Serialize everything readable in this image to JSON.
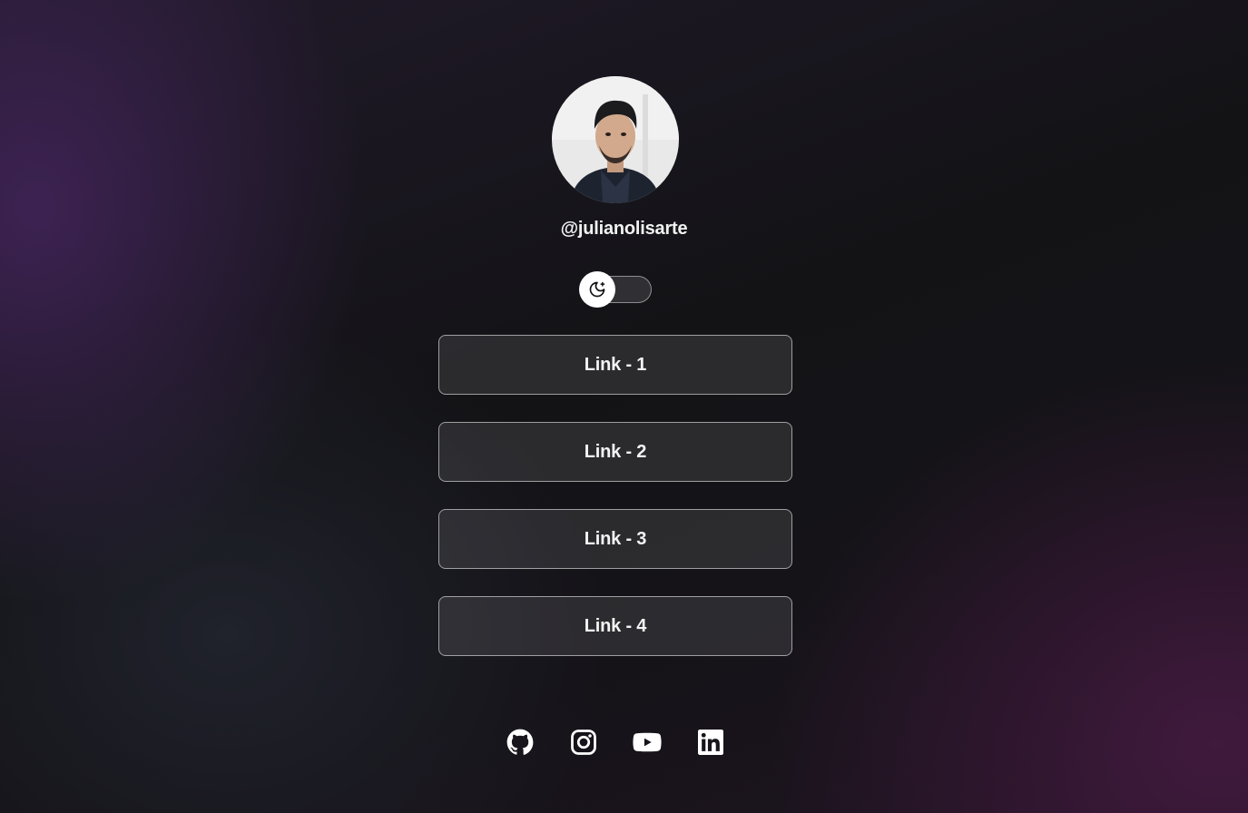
{
  "profile": {
    "username": "@julianolisarte",
    "avatar_icon": "profile-photo"
  },
  "theme_toggle": {
    "icon": "moon-stars-icon",
    "state": "dark"
  },
  "links": [
    {
      "label": "Link - 1"
    },
    {
      "label": "Link - 2"
    },
    {
      "label": "Link - 3"
    },
    {
      "label": "Link - 4"
    }
  ],
  "socials": [
    {
      "icon": "github-icon"
    },
    {
      "icon": "instagram-icon"
    },
    {
      "icon": "youtube-icon"
    },
    {
      "icon": "linkedin-icon"
    }
  ],
  "colors": {
    "background_dark": "#131316",
    "accent_purple": "#482662",
    "button_border": "#8c8c8c",
    "text": "#ffffff"
  }
}
